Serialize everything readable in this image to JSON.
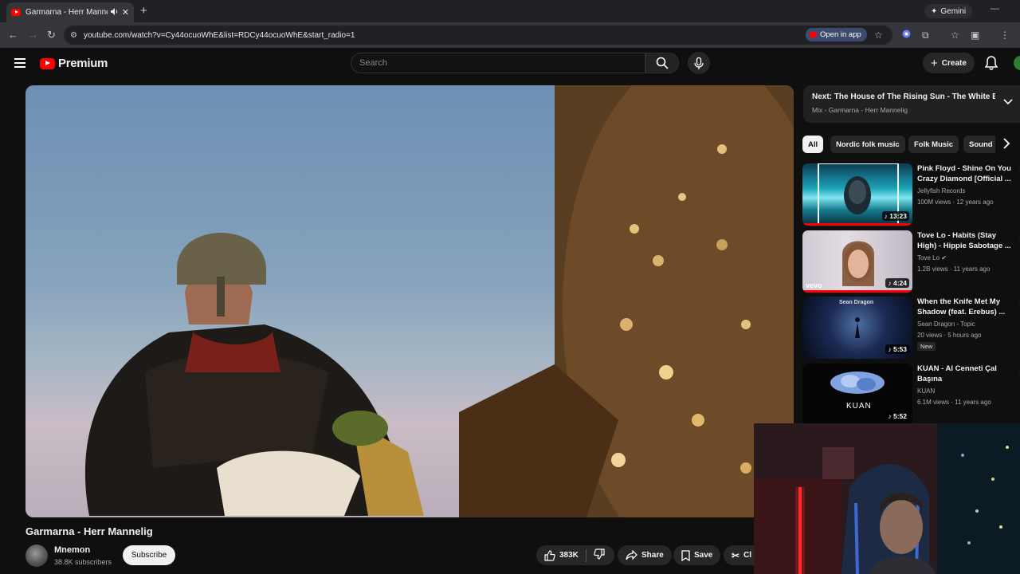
{
  "browser": {
    "tab_title": "Garmarna - Herr Mannelig",
    "audio_icon": "speaker-icon",
    "gemini_label": "Gemini",
    "url": "youtube.com/watch?v=Cy44ocuoWhE&list=RDCy44ocuoWhE&start_radio=1",
    "open_in_app": "Open in app"
  },
  "header": {
    "logo_text": "Premium",
    "search_placeholder": "Search",
    "create_label": "Create"
  },
  "video": {
    "title": "Garmarna - Herr Mannelig",
    "channel": "Mnemon",
    "subscribers": "38.8K subscribers",
    "subscribe_label": "Subscribe",
    "likes": "383K",
    "share_label": "Share",
    "save_label": "Save",
    "clip_label": "Cl"
  },
  "next": {
    "label": "Next:",
    "title": "The House of The Rising Sun - The White Buf...",
    "subtitle": "Mix - Garmarna - Herr Mannelig"
  },
  "chips": [
    "All",
    "Nordic folk music",
    "Folk Music",
    "Sound"
  ],
  "recommendations": [
    {
      "title": "Pink Floyd - Shine On You Crazy Diamond [Official ...",
      "channel": "Jellyfish Records",
      "meta": "100M views · 12 years ago",
      "duration": "13:23",
      "badge": ""
    },
    {
      "title": "Tove Lo - Habits (Stay High) - Hippie Sabotage ...",
      "channel": "Tove Lo",
      "meta": "1.2B views · 11 years ago",
      "duration": "4:24",
      "badge": "",
      "thumb_text": "vevo"
    },
    {
      "title": "When the Knife Met My Shadow (feat. Erebus) ...",
      "channel": "Sean Dragon - Topic",
      "meta": "20 views · 5 hours ago",
      "duration": "5:53",
      "badge": "New",
      "thumb_text": "Sean Dragon"
    },
    {
      "title": "KUAN - Al Cenneti Çal Başına",
      "channel": "KUAN",
      "meta": "6.1M views · 11 years ago",
      "duration": "5:52",
      "badge": "",
      "thumb_text": "KUAN"
    }
  ],
  "colors": {
    "accent": "#ff0000",
    "bg": "#0f0f0f",
    "chip_bg": "#272727"
  }
}
